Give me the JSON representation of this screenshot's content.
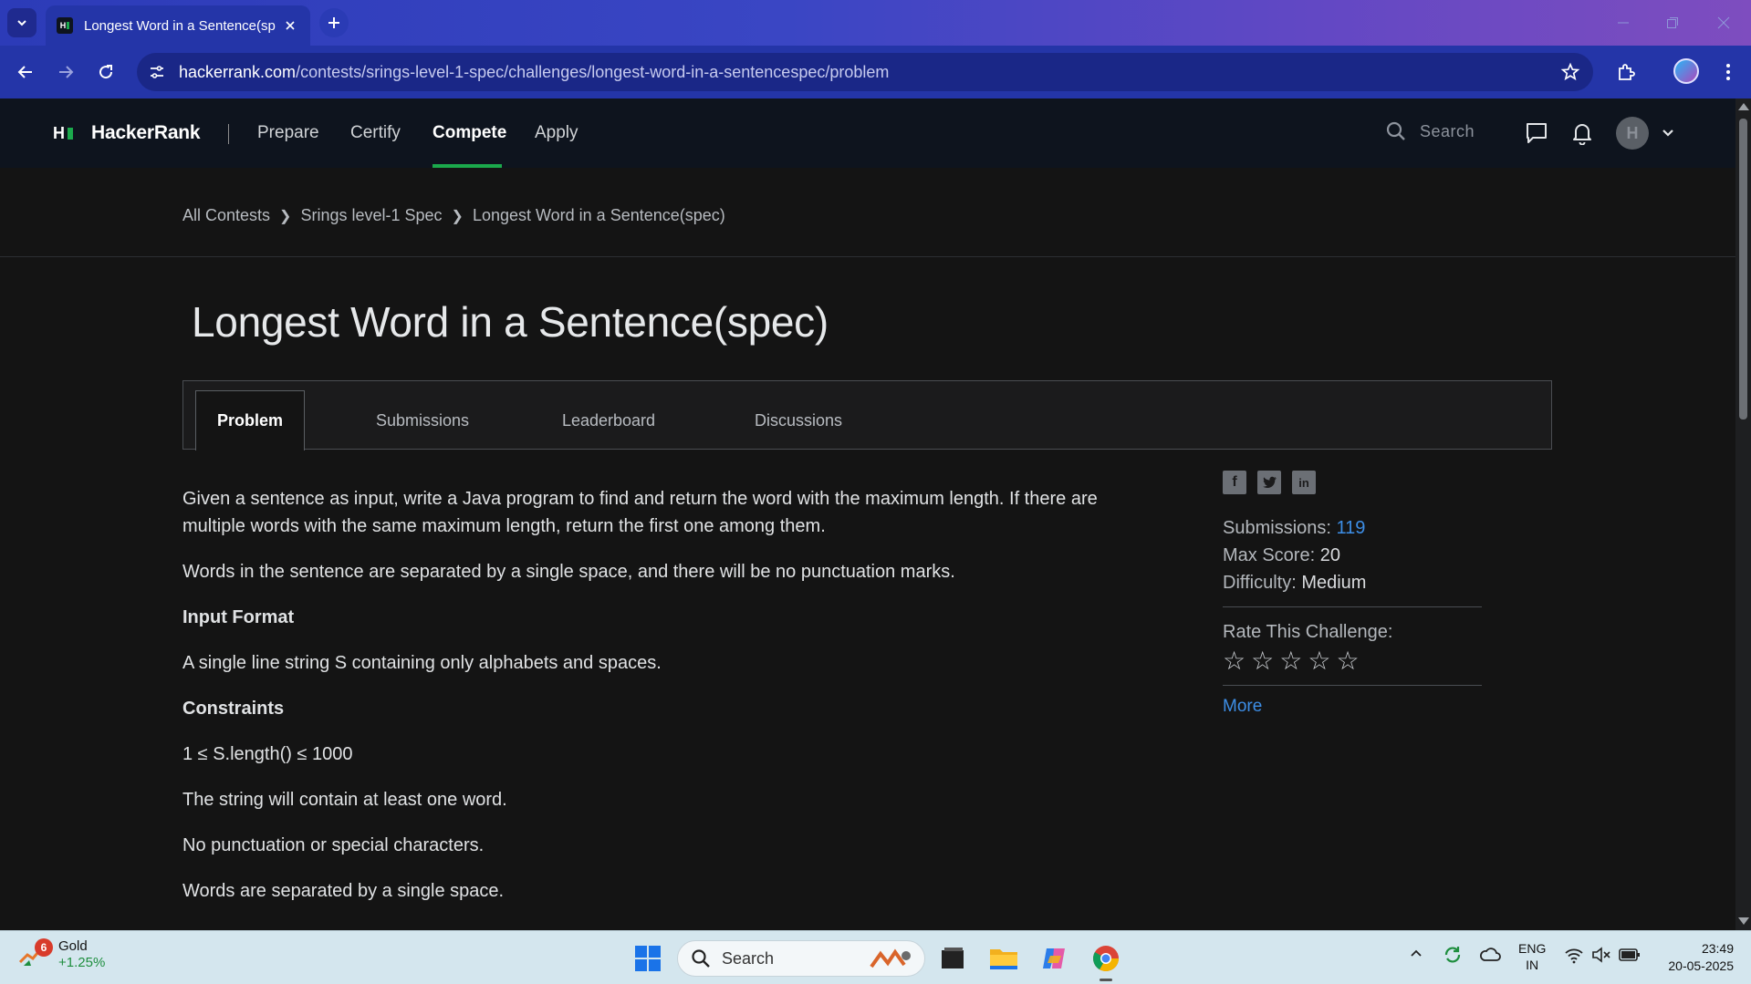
{
  "browser": {
    "tab_title": "Longest Word in a Sentence(spec)",
    "url_domain": "hackerrank.com",
    "url_path": "/contests/srings-level-1-spec/challenges/longest-word-in-a-sentencespec/problem"
  },
  "nav": {
    "logo_mark": "H",
    "brand": "HackerRank",
    "links": [
      "Prepare",
      "Certify",
      "Compete",
      "Apply"
    ],
    "active_link": "Compete",
    "search_placeholder": "Search",
    "avatar_letter": "H"
  },
  "breadcrumb": [
    "All Contests",
    "Srings level-1 Spec",
    "Longest Word in a Sentence(spec)"
  ],
  "challenge": {
    "title": "Longest Word in a Sentence(spec)",
    "tabs": [
      "Problem",
      "Submissions",
      "Leaderboard",
      "Discussions"
    ],
    "active_tab": "Problem",
    "description_1": "Given a sentence as input, write a Java program to find and return the word with the maximum length. If there are multiple words with the same maximum length, return the first one among them.",
    "description_2": "Words in the sentence are separated by a single space, and there will be no punctuation marks.",
    "input_format_heading": "Input Format",
    "input_format": "A single line string S containing only alphabets and spaces.",
    "constraints_heading": "Constraints",
    "constraints": [
      "1 ≤ S.length() ≤ 1000",
      "The string will contain at least one word.",
      "No punctuation or special characters.",
      "Words are separated by a single space."
    ]
  },
  "sidebar": {
    "submissions_label": "Submissions:",
    "submissions_value": "119",
    "max_score_label": "Max Score:",
    "max_score_value": "20",
    "difficulty_label": "Difficulty:",
    "difficulty_value": "Medium",
    "rate_label": "Rate This Challenge:",
    "rating": 0,
    "rating_max": 5,
    "more_label": "More"
  },
  "taskbar": {
    "weather_badge": "6",
    "weather_title": "Gold",
    "weather_change": "+1.25%",
    "search_placeholder": "Search",
    "lang_1": "ENG",
    "lang_2": "IN",
    "time": "23:49",
    "date": "20-05-2025"
  },
  "colors": {
    "hr_green": "#1ba94c",
    "link_blue": "#3d8ee6",
    "page_bg": "#141414",
    "nav_bg": "#0e141e",
    "chrome_blue": "#2435a8"
  }
}
